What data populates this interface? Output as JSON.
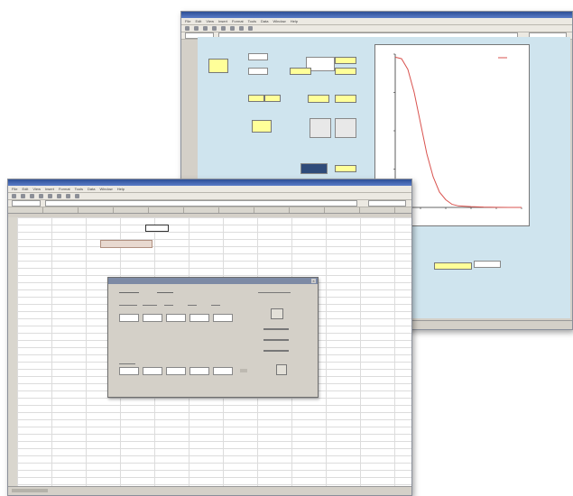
{
  "back_window": {
    "menu": [
      "File",
      "Edit",
      "View",
      "Insert",
      "Format",
      "Tools",
      "Data",
      "Window",
      "Help"
    ],
    "sheet_label": "Sheet 1",
    "chart_data": {
      "type": "line",
      "title": "",
      "xlabel": "",
      "ylabel": "",
      "legend": "top-right",
      "xlim": [
        0,
        10
      ],
      "ylim": [
        0,
        1
      ],
      "x": [
        0,
        0.5,
        1,
        1.5,
        2,
        2.5,
        3,
        3.5,
        4,
        4.5,
        5,
        6,
        7,
        8,
        9,
        10
      ],
      "series": [
        {
          "values": [
            0.98,
            0.97,
            0.9,
            0.75,
            0.55,
            0.35,
            0.2,
            0.1,
            0.05,
            0.02,
            0.01,
            0.005,
            0.002,
            0.001,
            0,
            0
          ]
        }
      ],
      "color": "#d9534f"
    }
  },
  "front_window": {
    "menu": [
      "File",
      "Edit",
      "View",
      "Insert",
      "Format",
      "Tools",
      "Data",
      "Window",
      "Help"
    ]
  },
  "colors": {
    "titlebar": "#2d4f96",
    "accent_yellow": "#ffff99",
    "panel_blue": "#cfe4ee",
    "curve": "#d9534f"
  }
}
